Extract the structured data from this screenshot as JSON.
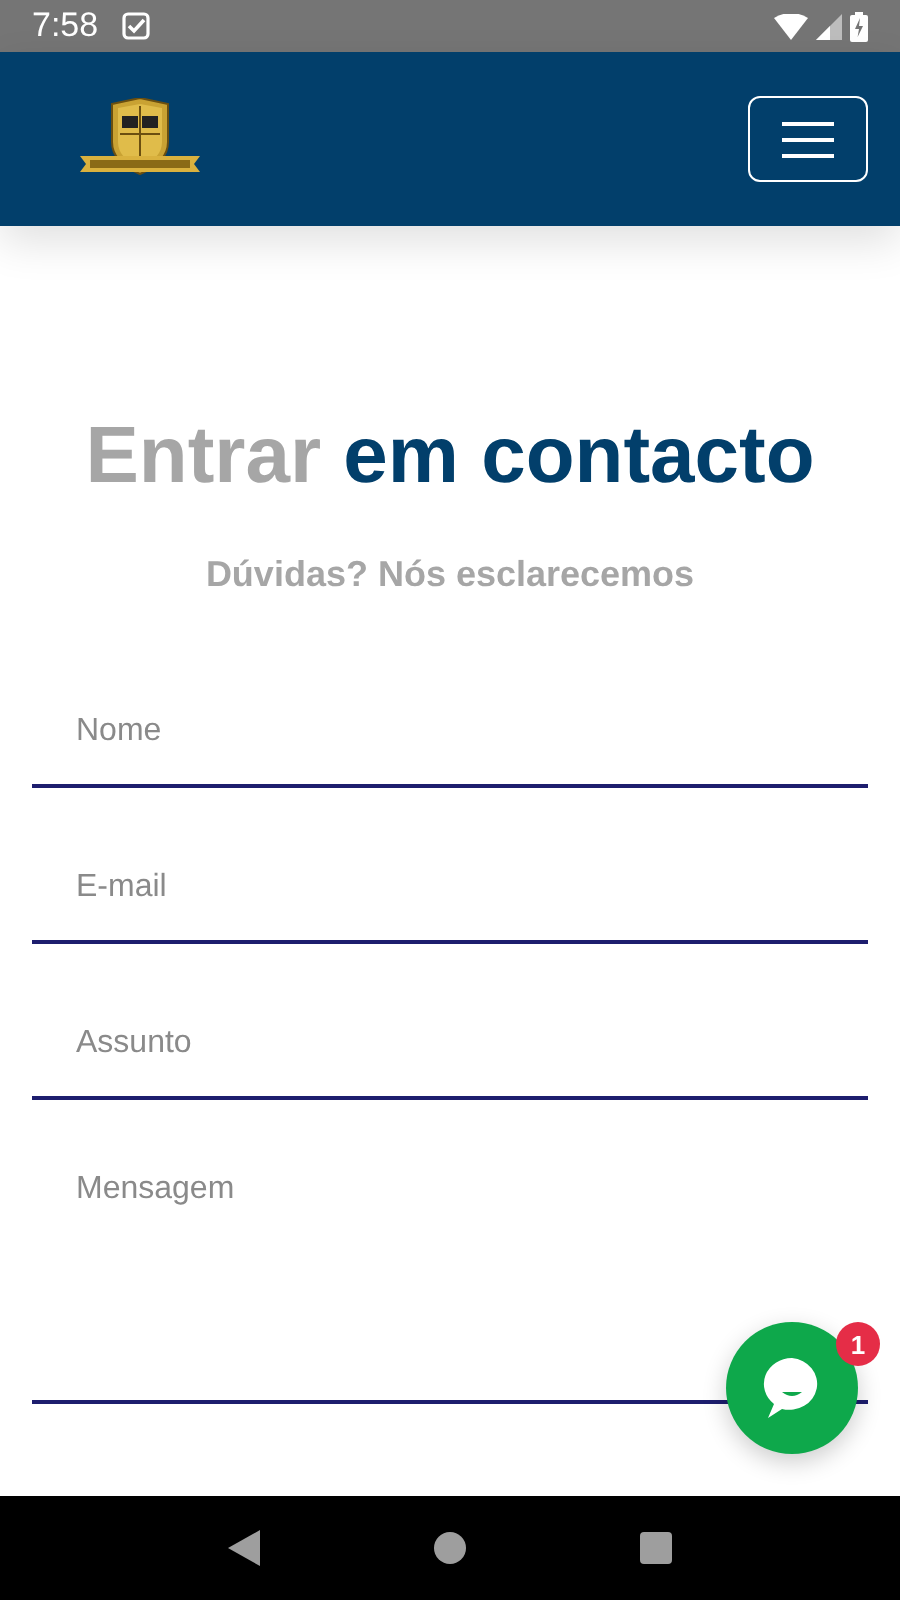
{
  "status_bar": {
    "time": "7:58"
  },
  "heading": {
    "part_1": "Entrar",
    "part_2": "em contacto"
  },
  "subtitle": "Dúvidas? Nós esclarecemos",
  "fields": [
    {
      "kind": "input",
      "placeholder": "Nome"
    },
    {
      "kind": "input",
      "placeholder": "E-mail"
    },
    {
      "kind": "input",
      "placeholder": "Assunto"
    },
    {
      "kind": "textarea",
      "placeholder": "Mensagem"
    }
  ],
  "chat": {
    "badge": "1"
  }
}
